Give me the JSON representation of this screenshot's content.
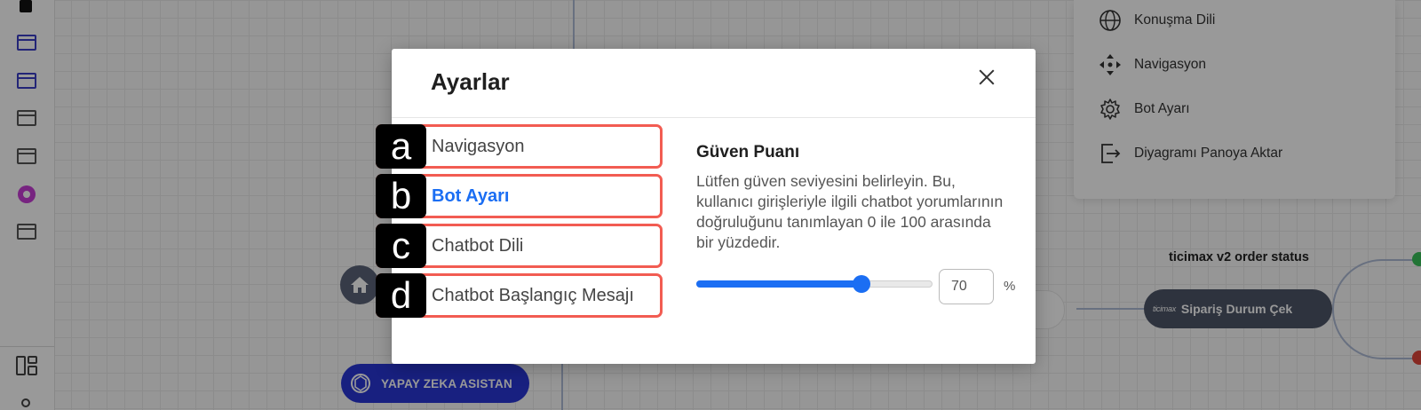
{
  "canvas": {
    "ctx_menu": {
      "items": [
        {
          "label": "Konuşma Dili",
          "icon": "globe-icon"
        },
        {
          "label": "Navigasyon",
          "icon": "move-arrows-icon"
        },
        {
          "label": "Bot Ayarı",
          "icon": "gear-icon"
        },
        {
          "label": "Diyagramı Panoya Aktar",
          "icon": "export-icon"
        }
      ]
    },
    "ai_node": {
      "label": "YAPAY ZEKA ASISTAN",
      "icon": "openai-icon"
    },
    "home_node": {
      "icon": "home-icon"
    },
    "order_node": {
      "title": "ticimax v2 order status",
      "brand": "ticimax",
      "label": "Sipariş Durum Çek"
    },
    "colors": {
      "edge_green": "#3ac15a",
      "edge_red": "#e0453a",
      "ai_node": "#2836d6"
    }
  },
  "modal": {
    "title": "Ayarlar",
    "tabs": [
      {
        "badge": "a",
        "label": "Navigasyon",
        "active": false
      },
      {
        "badge": "b",
        "label": "Bot Ayarı",
        "active": true
      },
      {
        "badge": "c",
        "label": "Chatbot Dili",
        "active": false
      },
      {
        "badge": "d",
        "label": "Chatbot Başlangıç Mesajı",
        "active": false
      }
    ],
    "panel": {
      "title": "Güven Puanı",
      "description": "Lütfen güven seviyesini belirleyin. Bu, kullanıcı girişleriyle ilgili chatbot yorumlarının doğruluğunu tanımlayan 0 ile 100 arasında bir yüzdedir.",
      "confidence_value": "70",
      "unit": "%",
      "slider_percent": 70
    },
    "accent_color": "#1b6ef3",
    "highlight_color": "#f25c52"
  }
}
